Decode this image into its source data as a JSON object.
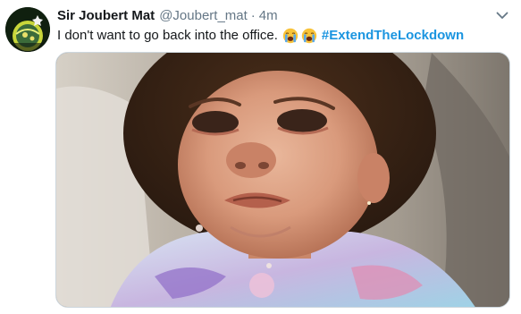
{
  "tweet": {
    "author": {
      "name": "Sir Joubert Mat",
      "handle": "@Joubert_mat"
    },
    "separator": "·",
    "time": "4m",
    "text": "I don't want to go back into the office.",
    "emojis": [
      "loudly-crying-face",
      "loudly-crying-face"
    ],
    "hashtag": "#ExtendTheLockdown",
    "media": {
      "type": "photo",
      "subject": "crying toddler"
    }
  },
  "colors": {
    "name": "#14171a",
    "muted": "#657786",
    "hashtag": "#1b95e0",
    "border": "#ccd6dd"
  },
  "icons": {
    "menu": "chevron-down-icon",
    "avatar": "avatar-image"
  }
}
